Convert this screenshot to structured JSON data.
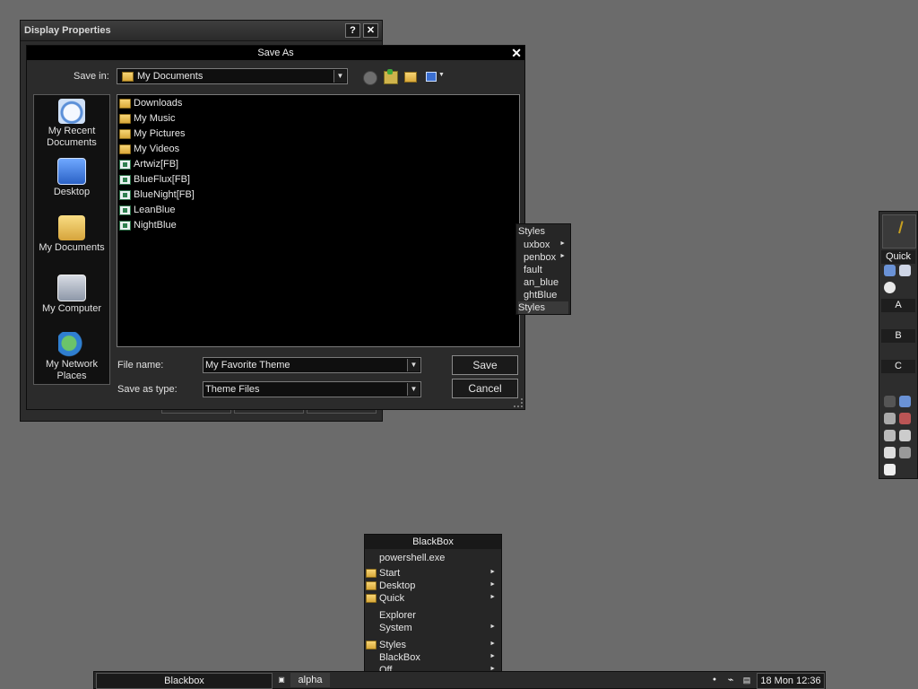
{
  "display_properties": {
    "title": "Display Properties",
    "help_glyph": "?",
    "close_glyph": "✕"
  },
  "save_as": {
    "title": "Save As",
    "close_glyph": "✕",
    "save_in_label": "Save in:",
    "save_in_value": "My Documents",
    "places": [
      "My Recent Documents",
      "Desktop",
      "My Documents",
      "My Computer",
      "My Network Places"
    ],
    "files": [
      {
        "name": "Downloads",
        "kind": "folder"
      },
      {
        "name": "My Music",
        "kind": "folder"
      },
      {
        "name": "My Pictures",
        "kind": "folder"
      },
      {
        "name": "My Videos",
        "kind": "folder"
      },
      {
        "name": "Artwiz[FB]",
        "kind": "theme"
      },
      {
        "name": "BlueFlux[FB]",
        "kind": "theme"
      },
      {
        "name": "BlueNight[FB]",
        "kind": "theme"
      },
      {
        "name": "LeanBlue",
        "kind": "theme"
      },
      {
        "name": "NightBlue",
        "kind": "theme"
      }
    ],
    "file_name_label": "File name:",
    "file_name_value": "My Favorite Theme",
    "save_as_type_label": "Save as type:",
    "save_as_type_value": "Theme Files",
    "save_button": "Save",
    "cancel_button": "Cancel"
  },
  "styles_menu": {
    "title": "Styles",
    "items": [
      "uxbox",
      "penbox",
      "fault",
      "an_blue",
      "ghtBlue",
      "Styles"
    ]
  },
  "slit": {
    "quick_label": "Quick",
    "labels": [
      "A",
      "B",
      "C"
    ]
  },
  "blackbox_menu": {
    "title": "BlackBox",
    "command": "powershell.exe",
    "items": [
      "Start",
      "Desktop",
      "Quick",
      "Explorer",
      "System",
      "Styles",
      "BlackBox",
      "Off"
    ]
  },
  "taskbar": {
    "workspace": "Blackbox",
    "task": "alpha",
    "clock": "18 Mon 12:36"
  },
  "colors": {
    "desktop": "#6b6b6b",
    "window": "#2b2b2b",
    "titlebar": "#000000"
  }
}
